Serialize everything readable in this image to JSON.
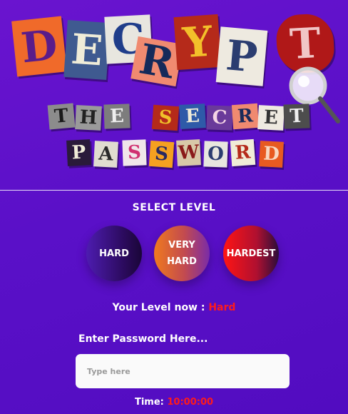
{
  "logo": {
    "title_letters": [
      "D",
      "E",
      "C",
      "R",
      "Y",
      "P",
      "T"
    ],
    "subtitle_row1": [
      "T",
      "H",
      "E",
      "S",
      "E",
      "C",
      "R",
      "E",
      "T"
    ],
    "subtitle_row2": [
      "P",
      "A",
      "S",
      "S",
      "W",
      "O",
      "R",
      "D"
    ],
    "icon": "magnifying-glass-icon"
  },
  "level": {
    "title": "SELECT LEVEL",
    "buttons": [
      {
        "line1": "HARD",
        "line2": ""
      },
      {
        "line1": "VERY",
        "line2": "HARD"
      },
      {
        "line1": "HARDEST",
        "line2": ""
      }
    ],
    "current_label": "Your Level now :",
    "current_value": "Hard"
  },
  "password": {
    "label": "Enter Password Here...",
    "placeholder": "Type here",
    "value": ""
  },
  "timer": {
    "label": "Time:",
    "value": "10:00:00"
  },
  "colors": {
    "background": "#5a10c8",
    "accent_red": "#ff1b1b"
  }
}
